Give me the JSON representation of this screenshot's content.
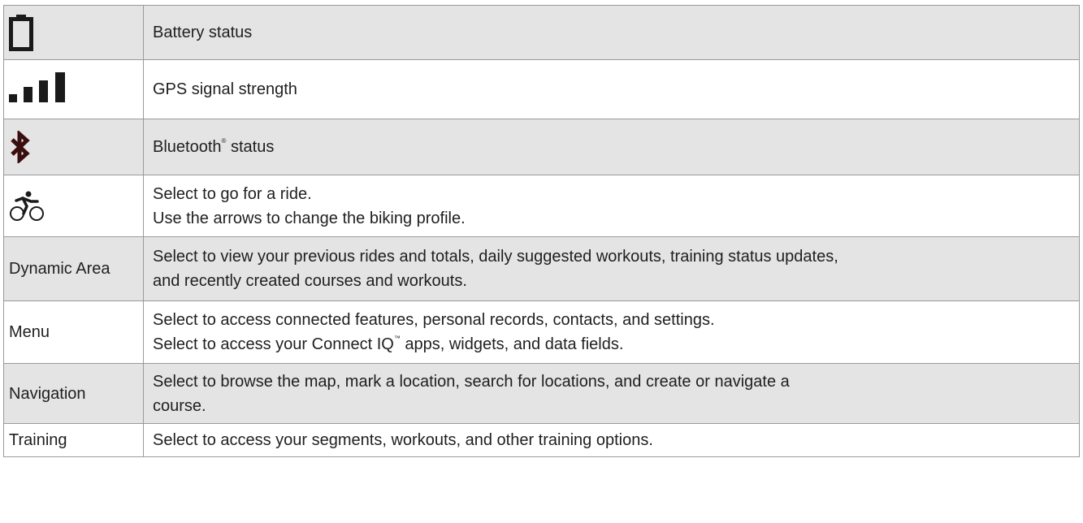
{
  "rows": [
    {
      "icon": "battery-icon",
      "lines": [
        "Battery status"
      ]
    },
    {
      "icon": "gps-signal-icon",
      "lines": [
        "GPS signal strength"
      ]
    },
    {
      "icon": "bluetooth-icon",
      "text_before": "Bluetooth",
      "mark": "®",
      "text_after": " status"
    },
    {
      "icon": "bike-icon",
      "lines": [
        "Select to go for a ride.",
        "Use the arrows to change the biking profile."
      ]
    },
    {
      "label": "Dynamic Area",
      "lines": [
        "Select to view your previous rides and totals, daily suggested workouts, training status updates,",
        "and recently created courses and workouts."
      ]
    },
    {
      "label": "Menu",
      "line1": "Select to access connected features, personal records, contacts, and settings.",
      "line2_before": "Select to access your Connect IQ",
      "line2_mark": "™",
      "line2_after": " apps, widgets, and data fields."
    },
    {
      "label": "Navigation",
      "lines": [
        "Select to browse the map, mark a location, search for locations, and create or navigate a",
        "course."
      ]
    },
    {
      "label": "Training",
      "lines": [
        "Select to access your segments, workouts, and other training options."
      ]
    }
  ]
}
